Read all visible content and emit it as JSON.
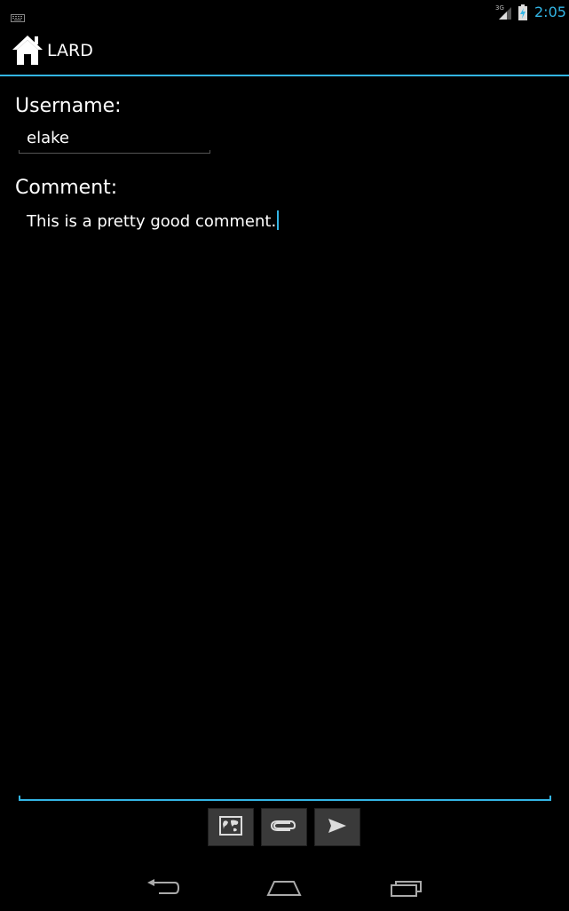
{
  "status_bar": {
    "time": "2:05",
    "network": "3G",
    "icons": [
      "keyboard-icon",
      "signal-icon",
      "battery-charging-icon"
    ],
    "accent_color": "#33b5e5"
  },
  "action_bar": {
    "title": "LARD",
    "icon": "home-icon"
  },
  "form": {
    "username_label": "Username:",
    "username_value": "elake",
    "comment_label": "Comment:",
    "comment_value": "This is a pretty good comment."
  },
  "toolbar": {
    "buttons": [
      {
        "icon": "map-icon"
      },
      {
        "icon": "paperclip-icon"
      },
      {
        "icon": "send-icon"
      }
    ]
  },
  "nav_bar": {
    "icons": [
      "back-icon",
      "home-nav-icon",
      "recent-apps-icon"
    ]
  }
}
